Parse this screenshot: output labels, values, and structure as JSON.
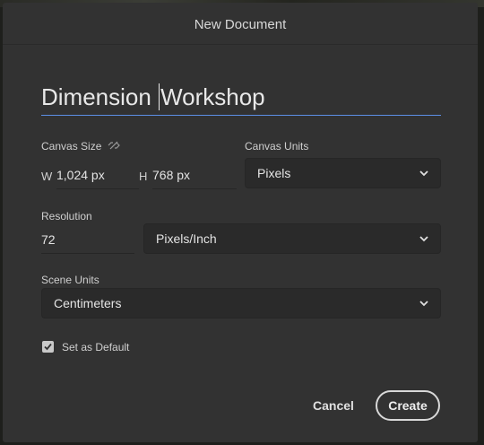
{
  "dialog": {
    "title": "New Document"
  },
  "document_name": {
    "before_caret": "Dimension ",
    "after_caret": "Workshop"
  },
  "canvas_size": {
    "label": "Canvas Size",
    "width_prefix": "W",
    "width_value": "1,024 px",
    "height_prefix": "H",
    "height_value": "768 px",
    "link_icon": "unlink-icon"
  },
  "canvas_units": {
    "label": "Canvas Units",
    "selected": "Pixels"
  },
  "resolution": {
    "label": "Resolution",
    "value": "72",
    "unit_selected": "Pixels/Inch"
  },
  "scene_units": {
    "label": "Scene Units",
    "selected": "Centimeters"
  },
  "set_default": {
    "label": "Set as Default",
    "checked": true
  },
  "buttons": {
    "cancel": "Cancel",
    "create": "Create"
  },
  "colors": {
    "focus_underline": "#5c8fe6",
    "dialog_bg": "#323232",
    "field_bg": "#2a2a2a"
  }
}
